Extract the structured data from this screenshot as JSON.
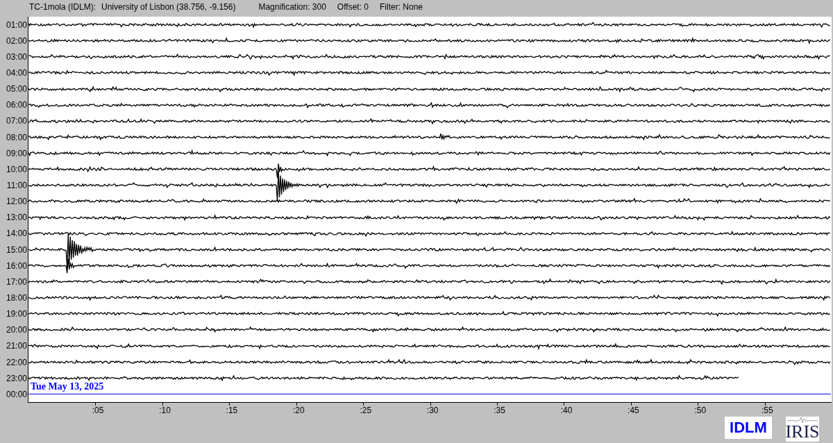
{
  "header": {
    "station": "TC-1mola (IDLM):",
    "location": "University of Lisbon (38.756, -9.156)",
    "magnification": "Magnification: 300",
    "offset": "Offset: 0",
    "filter": "Filter: None"
  },
  "rows": [
    {
      "time": "01:00",
      "kind": "trace"
    },
    {
      "time": "02:00",
      "kind": "trace"
    },
    {
      "time": "03:00",
      "kind": "trace"
    },
    {
      "time": "04:00",
      "kind": "trace"
    },
    {
      "time": "05:00",
      "kind": "trace"
    },
    {
      "time": "06:00",
      "kind": "trace"
    },
    {
      "time": "07:00",
      "kind": "trace"
    },
    {
      "time": "08:00",
      "kind": "trace"
    },
    {
      "time": "09:00",
      "kind": "trace"
    },
    {
      "time": "10:00",
      "kind": "trace"
    },
    {
      "time": "11:00",
      "kind": "trace"
    },
    {
      "time": "12:00",
      "kind": "trace"
    },
    {
      "time": "13:00",
      "kind": "trace"
    },
    {
      "time": "14:00",
      "kind": "trace"
    },
    {
      "time": "15:00",
      "kind": "trace"
    },
    {
      "time": "16:00",
      "kind": "trace"
    },
    {
      "time": "17:00",
      "kind": "trace"
    },
    {
      "time": "18:00",
      "kind": "trace"
    },
    {
      "time": "19:00",
      "kind": "trace"
    },
    {
      "time": "20:00",
      "kind": "trace"
    },
    {
      "time": "21:00",
      "kind": "trace"
    },
    {
      "time": "22:00",
      "kind": "trace"
    },
    {
      "time": "23:00",
      "kind": "trace"
    },
    {
      "time": "00:00",
      "kind": "current",
      "date": "Tue May 13, 2025"
    }
  ],
  "axis": {
    "ticks": [
      ":05",
      ":10",
      ":15",
      ":20",
      ":25",
      ":30",
      ":35",
      ":40",
      ":45",
      ":50",
      ":55"
    ]
  },
  "logos": {
    "station": "IDLM",
    "network": "IRIS"
  }
}
